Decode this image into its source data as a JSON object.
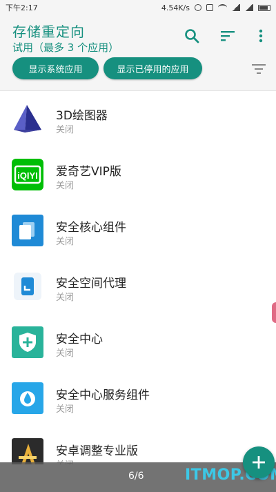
{
  "status_bar": {
    "time": "下午2:17",
    "speed": "4.54K/s",
    "battery": "▭"
  },
  "header": {
    "title": "存储重定向",
    "subtitle": "试用（最多 3 个应用）"
  },
  "chips": {
    "show_system": "显示系统应用",
    "show_disabled": "显示已停用的应用"
  },
  "apps": [
    {
      "name": "3D绘图器",
      "status": "关闭"
    },
    {
      "name": "爱奇艺VIP版",
      "status": "关闭"
    },
    {
      "name": "安全核心组件",
      "status": "关闭"
    },
    {
      "name": "安全空间代理",
      "status": "关闭"
    },
    {
      "name": "安全中心",
      "status": "关闭"
    },
    {
      "name": "安全中心服务组件",
      "status": "关闭"
    },
    {
      "name": "安卓调整专业版",
      "status": "关闭"
    }
  ],
  "pager": "6/6",
  "watermark": "ITMOP.COM",
  "colors": {
    "accent": "#16907f",
    "iqiyi": "#00be06",
    "blue": "#1f8ad6",
    "watermark": "#3cc8e6"
  }
}
